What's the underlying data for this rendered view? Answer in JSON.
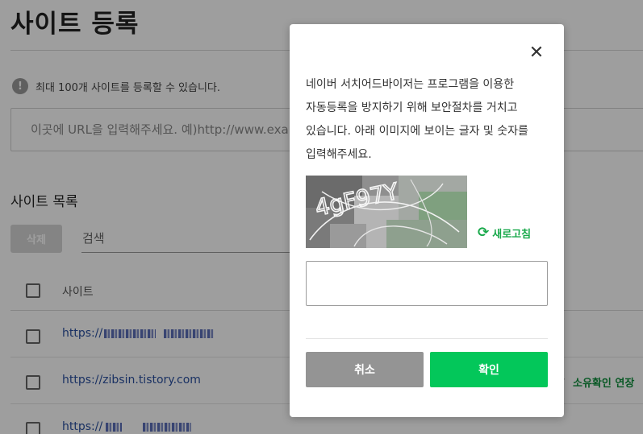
{
  "page": {
    "title": "사이트 등록",
    "notice_icon": "info-icon",
    "notice_text": "최대 100개 사이트를 등록할 수 있습니다.",
    "url_input_placeholder": "이곳에 URL을 입력해주세요. 예)http://www.example.com",
    "list_title": "사이트 목록",
    "delete_label": "삭제",
    "search_placeholder": "검색",
    "column_site": "사이트",
    "rows": [
      {
        "site": "https://"
      },
      {
        "site": "https://zibsin.tistory.com",
        "action": "소유확인 연장"
      },
      {
        "site": "https://"
      }
    ]
  },
  "modal": {
    "close_icon": "close-icon",
    "description": "네이버 서치어드바이저는 프로그램을 이용한 자동등록을 방지하기 위해 보안절차를 거치고 있습니다. 아래 이미지에 보이는 글자 및 숫자를 입력해주세요.",
    "captcha_text": "4gF97Y",
    "refresh_label": "새로고침",
    "refresh_icon": "refresh-icon",
    "answer_value": "",
    "cancel_label": "취소",
    "confirm_label": "확인"
  },
  "colors": {
    "brand_green": "#03c75a",
    "link_blue": "#2a50a0",
    "cancel_gray": "#949494"
  }
}
